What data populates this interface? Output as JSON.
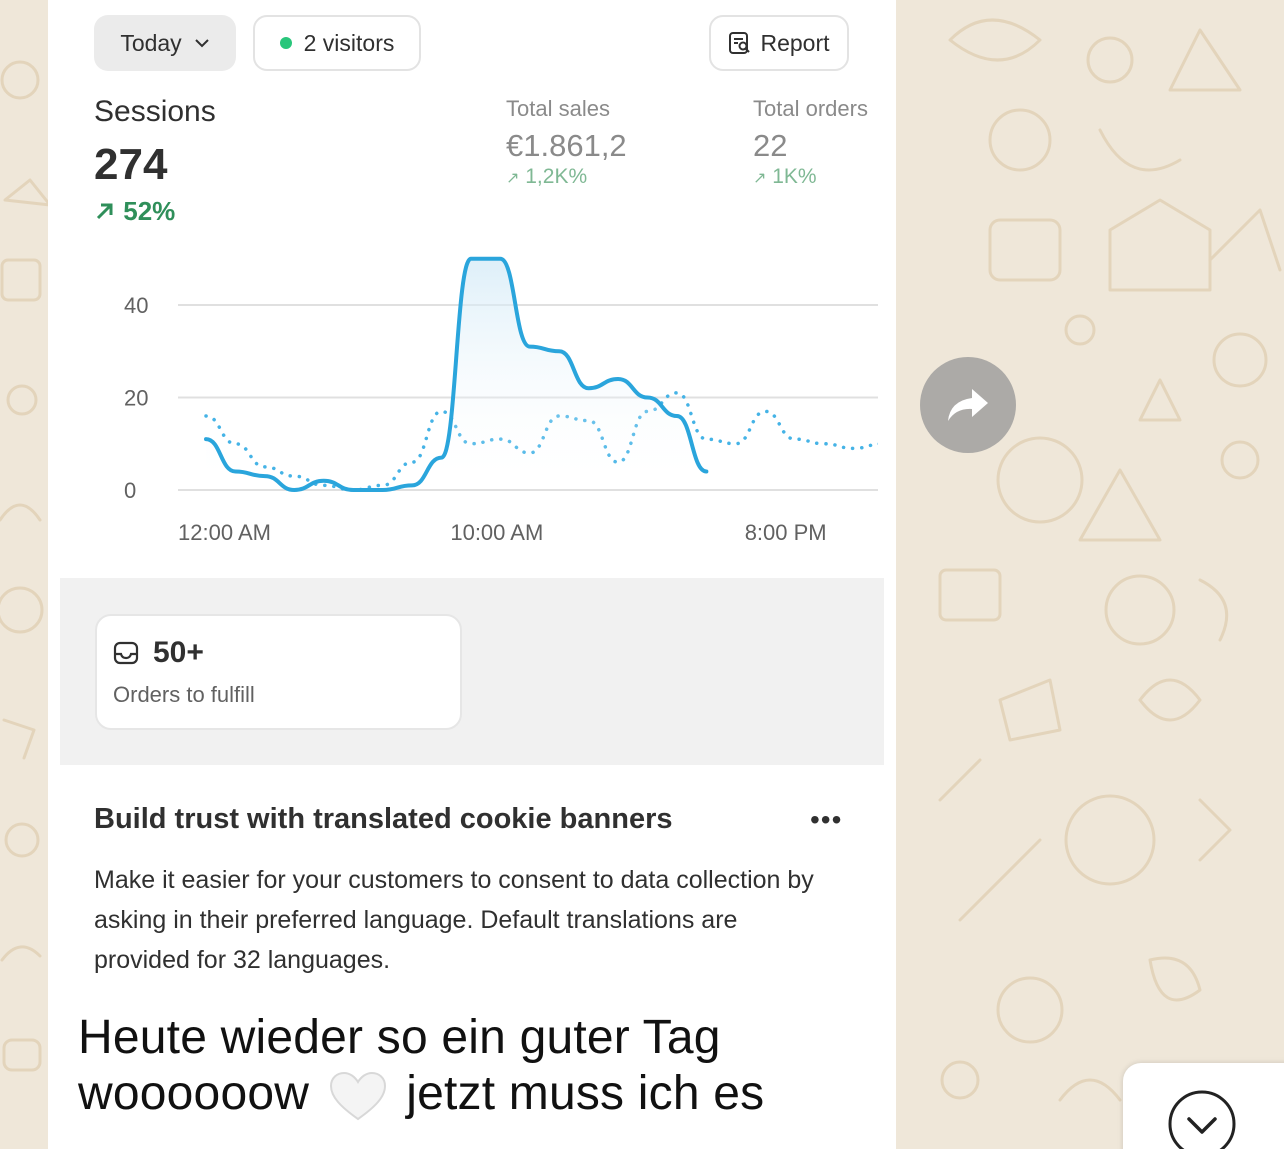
{
  "dashboard": {
    "date_filter": "Today",
    "visitors": "2 visitors",
    "report_label": "Report",
    "sessions": {
      "label": "Sessions",
      "value": "274",
      "change": "52%"
    },
    "total_sales": {
      "label": "Total sales",
      "value": "€1.861,2",
      "change": "1,2K%"
    },
    "total_orders": {
      "label": "Total orders",
      "value": "22",
      "change": "1K%"
    }
  },
  "chart_data": {
    "type": "line",
    "x": [
      "12:00 AM",
      "1:00 AM",
      "2:00 AM",
      "3:00 AM",
      "4:00 AM",
      "5:00 AM",
      "6:00 AM",
      "7:00 AM",
      "8:00 AM",
      "9:00 AM",
      "10:00 AM",
      "11:00 AM",
      "12:00 PM",
      "1:00 PM",
      "2:00 PM",
      "3:00 PM",
      "4:00 PM",
      "5:00 PM",
      "6:00 PM",
      "7:00 PM",
      "8:00 PM",
      "9:00 PM",
      "10:00 PM",
      "11:00 PM"
    ],
    "xticks": [
      "12:00 AM",
      "10:00 AM",
      "8:00 PM"
    ],
    "yticks": [
      "0",
      "20",
      "40"
    ],
    "ylim": [
      0,
      50
    ],
    "series": [
      {
        "style": "solid",
        "color": "#2aa5dc",
        "values": [
          11,
          4,
          3,
          0,
          2,
          0,
          0,
          1,
          7,
          50,
          50,
          31,
          30,
          22,
          24,
          20,
          16,
          4,
          null,
          null,
          null,
          null,
          null,
          null
        ]
      },
      {
        "style": "dotted",
        "color": "#45b3e6",
        "values": [
          16,
          10,
          5,
          3,
          1,
          0,
          1,
          6,
          17,
          10,
          11,
          8,
          16,
          15,
          6,
          17,
          21,
          11,
          10,
          17,
          11,
          10,
          9,
          10
        ]
      }
    ],
    "grid": true
  },
  "orders_card": {
    "value": "50+",
    "label": "Orders to fulfill"
  },
  "banner": {
    "title": "Build trust with translated cookie banners",
    "more": "•••",
    "body": "Make it easier for your customers to consent to data collection by asking in their preferred language. Default translations are provided for 32 languages."
  },
  "message": {
    "line1": "Heute wieder so ein guter Tag",
    "line2a": "woooooow",
    "line2b": "jetzt muss ich es"
  },
  "icons": [
    "chevron-down-icon",
    "report-icon",
    "inbox-icon",
    "white-heart-icon",
    "forward-icon",
    "scroll-down-icon"
  ]
}
